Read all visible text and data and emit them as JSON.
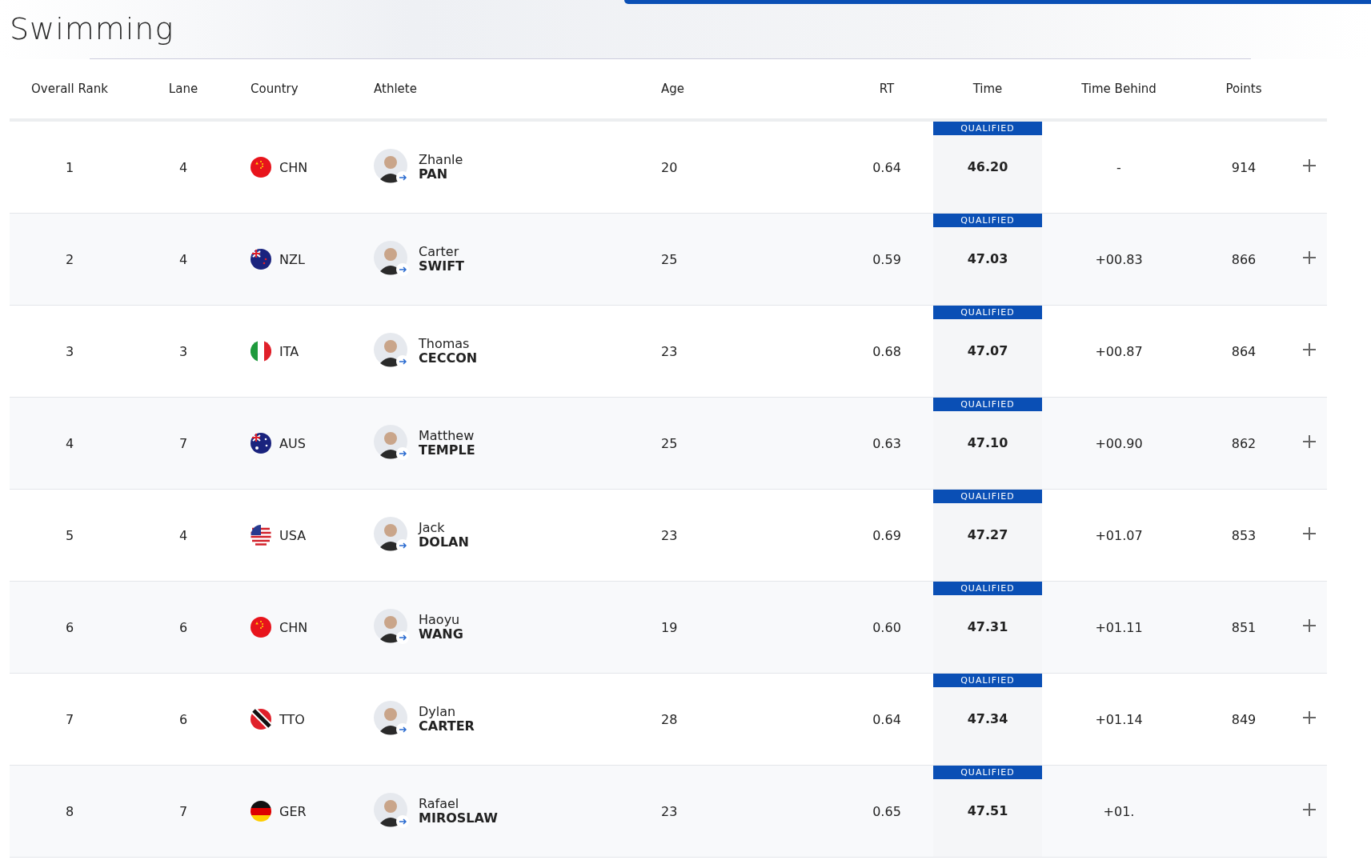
{
  "title": "Swimming",
  "columns": [
    "Overall Rank",
    "Lane",
    "Country",
    "Athlete",
    "Age",
    "RT",
    "Time",
    "Time Behind",
    "Points"
  ],
  "rows": [
    {
      "rank": "1",
      "lane": "4",
      "country": "CHN",
      "first_name": "Zhanle",
      "last_name": "PAN",
      "age": "20",
      "rt": "0.64",
      "time": "46.20",
      "badge": "QUALIFIED",
      "time_behind": "-",
      "points": "914"
    },
    {
      "rank": "2",
      "lane": "4",
      "country": "NZL",
      "first_name": "Carter",
      "last_name": "SWIFT",
      "age": "25",
      "rt": "0.59",
      "time": "47.03",
      "badge": "QUALIFIED",
      "time_behind": "+00.83",
      "points": "866"
    },
    {
      "rank": "3",
      "lane": "3",
      "country": "ITA",
      "first_name": "Thomas",
      "last_name": "CECCON",
      "age": "23",
      "rt": "0.68",
      "time": "47.07",
      "badge": "QUALIFIED",
      "time_behind": "+00.87",
      "points": "864"
    },
    {
      "rank": "4",
      "lane": "7",
      "country": "AUS",
      "first_name": "Matthew",
      "last_name": "TEMPLE",
      "age": "25",
      "rt": "0.63",
      "time": "47.10",
      "badge": "QUALIFIED",
      "time_behind": "+00.90",
      "points": "862"
    },
    {
      "rank": "5",
      "lane": "4",
      "country": "USA",
      "first_name": "Jack",
      "last_name": "DOLAN",
      "age": "23",
      "rt": "0.69",
      "time": "47.27",
      "badge": "QUALIFIED",
      "time_behind": "+01.07",
      "points": "853"
    },
    {
      "rank": "6",
      "lane": "6",
      "country": "CHN",
      "first_name": "Haoyu",
      "last_name": "WANG",
      "age": "19",
      "rt": "0.60",
      "time": "47.31",
      "badge": "QUALIFIED",
      "time_behind": "+01.11",
      "points": "851"
    },
    {
      "rank": "7",
      "lane": "6",
      "country": "TTO",
      "first_name": "Dylan",
      "last_name": "CARTER",
      "age": "28",
      "rt": "0.64",
      "time": "47.34",
      "badge": "QUALIFIED",
      "time_behind": "+01.14",
      "points": "849"
    },
    {
      "rank": "8",
      "lane": "7",
      "country": "GER",
      "first_name": "Rafael",
      "last_name": "MIROSLAW",
      "age": "23",
      "rt": "0.65",
      "time": "47.51",
      "badge": "QUALIFIED",
      "time_behind": "+01."
    }
  ]
}
